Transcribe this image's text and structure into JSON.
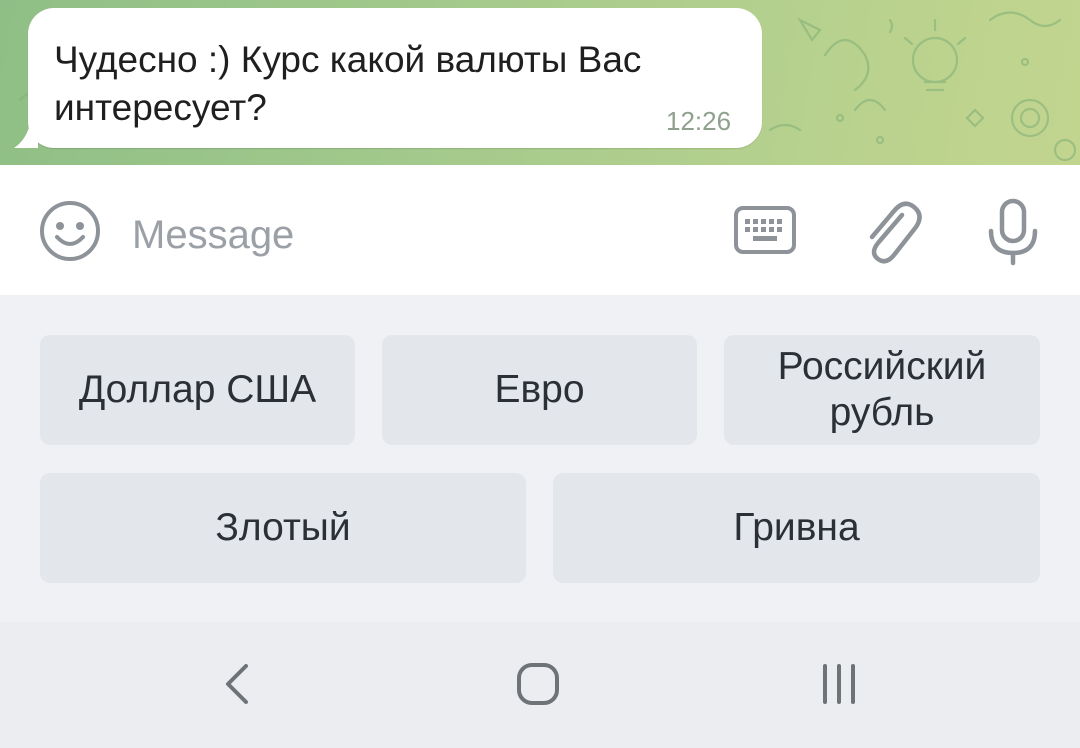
{
  "chat": {
    "message": {
      "text": "Чудесно :) Курс какой валюты Вас интересует?",
      "time": "12:26"
    }
  },
  "composer": {
    "placeholder": "Message",
    "icons": [
      "emoji-icon",
      "keyboard-icon",
      "paperclip-icon",
      "microphone-icon"
    ]
  },
  "reply_keyboard": {
    "buttons": [
      {
        "label": "Доллар США"
      },
      {
        "label": "Евро"
      },
      {
        "label": "Российский рубль"
      },
      {
        "label": "Злотый"
      },
      {
        "label": "Гривна"
      }
    ]
  },
  "nav": {
    "icons": [
      "back-icon",
      "home-icon",
      "recent-apps-icon"
    ]
  },
  "colors": {
    "chat_background": "#a3c98c",
    "bubble": "#ffffff",
    "button": "#e3e6ea",
    "icon": "#8d9399"
  }
}
